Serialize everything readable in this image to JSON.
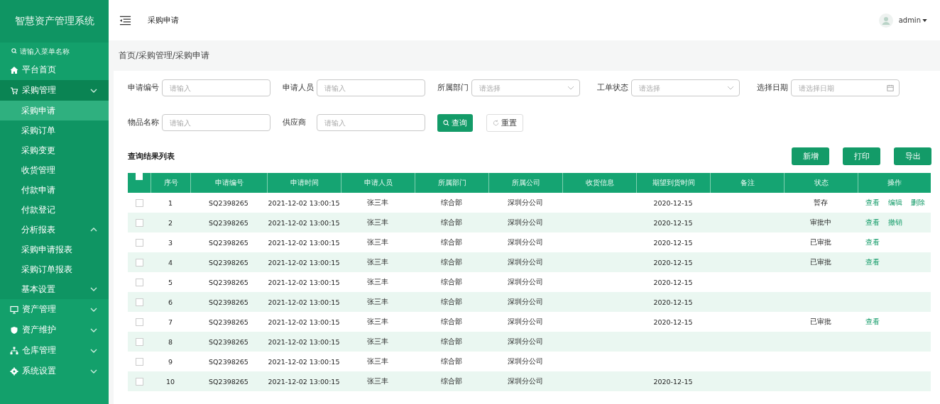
{
  "sidebar": {
    "title": "智慧资产管理系统",
    "search_placeholder": "请输入菜单名称",
    "items": [
      {
        "label": "平台首页",
        "selected": false
      },
      {
        "label": "采购管理",
        "expanded": true,
        "selected": false,
        "children": [
          {
            "label": "采购申请",
            "selected": true
          },
          {
            "label": "采购订单",
            "selected": false
          },
          {
            "label": "采购变更",
            "selected": false
          },
          {
            "label": "收货管理",
            "selected": false
          },
          {
            "label": "付款申请",
            "selected": false
          },
          {
            "label": "付款登记",
            "selected": false
          },
          {
            "label": "分析报表",
            "selected": false,
            "expanded": true,
            "children": [
              {
                "label": "采购申请报表",
                "selected": false
              },
              {
                "label": "采购订单报表",
                "selected": false
              }
            ]
          },
          {
            "label": "基本设置",
            "selected": false,
            "expanded": false
          }
        ]
      },
      {
        "label": "资产管理",
        "expanded": false,
        "selected": false
      },
      {
        "label": "资产维护",
        "expanded": false,
        "selected": false
      },
      {
        "label": "仓库管理",
        "expanded": false,
        "selected": false
      },
      {
        "label": "系统设置",
        "expanded": false,
        "selected": false
      }
    ]
  },
  "topbar": {
    "page_title": "采购申请",
    "user": "admin"
  },
  "breadcrumb": "首页/采购管理/采购申请",
  "filters": [
    [
      {
        "label": "申请编号",
        "placeholder": "请输入",
        "kind": "input"
      },
      {
        "label": "申请人员",
        "placeholder": "请输入",
        "kind": "input"
      },
      {
        "label": "所属部门",
        "placeholder": "请选择",
        "kind": "select"
      },
      {
        "label": "工单状态",
        "placeholder": "请选择",
        "kind": "select"
      },
      {
        "label": "选择日期",
        "placeholder": "请选择日期",
        "kind": "date"
      }
    ],
    [
      {
        "label": "物品名称",
        "placeholder": "请输入",
        "kind": "input"
      },
      {
        "label": "供应商",
        "placeholder": "请输入",
        "kind": "input"
      }
    ]
  ],
  "filter_buttons": [
    {
      "label": "查询",
      "kind": "primary"
    },
    {
      "label": "重置",
      "kind": "plain"
    }
  ],
  "results": {
    "title": "查询结果列表",
    "actions": [
      "新增",
      "打印",
      "导出"
    ],
    "select_all": {
      "checked": false
    },
    "columns": [
      "序号",
      "申请编号",
      "申请时间",
      "申请人员",
      "所属部门",
      "所属公司",
      "收货信息",
      "期望到货时间",
      "备注",
      "状态",
      "操作"
    ],
    "rows": [
      {
        "checked": false,
        "cells": [
          "1",
          "SQ2398265",
          "2021-12-02 13:00:15",
          "张三丰",
          "综合部",
          "深圳分公司",
          "",
          "2020-12-15",
          "",
          "暂存"
        ],
        "ops": [
          "查看",
          "编辑",
          "删除"
        ]
      },
      {
        "checked": false,
        "cells": [
          "2",
          "SQ2398265",
          "2021-12-02 13:00:15",
          "张三丰",
          "综合部",
          "深圳分公司",
          "",
          "2020-12-15",
          "",
          "审批中"
        ],
        "ops": [
          "查看",
          "撤销"
        ]
      },
      {
        "checked": false,
        "cells": [
          "3",
          "SQ2398265",
          "2021-12-02 13:00:15",
          "张三丰",
          "综合部",
          "深圳分公司",
          "",
          "2020-12-15",
          "",
          "已审批"
        ],
        "ops": [
          "查看"
        ]
      },
      {
        "checked": false,
        "cells": [
          "4",
          "SQ2398265",
          "2021-12-02 13:00:15",
          "张三丰",
          "综合部",
          "深圳分公司",
          "",
          "2020-12-15",
          "",
          "已审批"
        ],
        "ops": [
          "查看"
        ]
      },
      {
        "checked": false,
        "cells": [
          "5",
          "SQ2398265",
          "2021-12-02 13:00:15",
          "张三丰",
          "综合部",
          "深圳分公司",
          "",
          "2020-12-15",
          "",
          ""
        ],
        "ops": []
      },
      {
        "checked": false,
        "cells": [
          "6",
          "SQ2398265",
          "2021-12-02 13:00:15",
          "张三丰",
          "综合部",
          "深圳分公司",
          "",
          "2020-12-15",
          "",
          ""
        ],
        "ops": []
      },
      {
        "checked": false,
        "cells": [
          "7",
          "SQ2398265",
          "2021-12-02 13:00:15",
          "张三丰",
          "综合部",
          "深圳分公司",
          "",
          "2020-12-15",
          "",
          "已审批"
        ],
        "ops": [
          "查看"
        ]
      },
      {
        "checked": false,
        "cells": [
          "8",
          "SQ2398265",
          "2021-12-02 13:00:15",
          "张三丰",
          "综合部",
          "深圳分公司",
          "",
          "",
          "",
          ""
        ],
        "ops": []
      },
      {
        "checked": false,
        "cells": [
          "9",
          "SQ2398265",
          "2021-12-02 13:00:15",
          "张三丰",
          "综合部",
          "深圳分公司",
          "",
          "",
          "",
          ""
        ],
        "ops": []
      },
      {
        "checked": false,
        "cells": [
          "10",
          "SQ2398265",
          "2021-12-02 13:00:15",
          "张三丰",
          "综合部",
          "深圳分公司",
          "",
          "2020-12-15",
          "",
          ""
        ],
        "ops": []
      }
    ]
  }
}
